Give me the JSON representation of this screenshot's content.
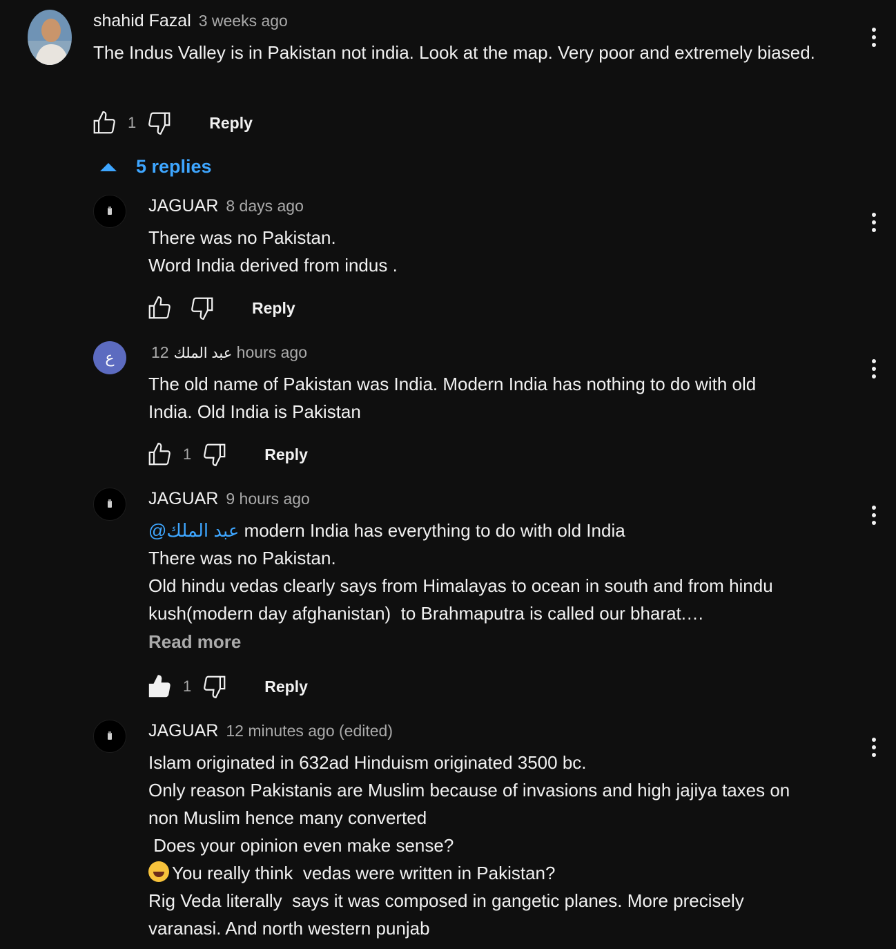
{
  "colors": {
    "background": "#0f0f0f",
    "text": "#f1f1f1",
    "muted": "#aaaaaa",
    "link": "#3ea6ff",
    "avatar_purple": "#5c6bc0"
  },
  "top_comment": {
    "author": "shahid Fazal",
    "time": "3 weeks ago",
    "text": "The Indus Valley is in Pakistan not india. Look at the map. Very poor and extremely biased.",
    "likes": "1",
    "reply_label": "Reply"
  },
  "replies_toggle": {
    "label": "5 replies",
    "icon": "triangle-up-icon"
  },
  "replies": [
    {
      "author": "JAGUAR",
      "time": "8 days ago",
      "lines": [
        "There was no Pakistan.",
        "Word India derived from indus ."
      ],
      "likes": "",
      "reply_label": "Reply"
    },
    {
      "author": "عبد الملك",
      "avatar_letter": "ع",
      "time": "12 hours ago",
      "lines": [
        "The old name of Pakistan was India. Modern India has nothing to do with old",
        "India. Old India is Pakistan"
      ],
      "likes": "1",
      "reply_label": "Reply"
    },
    {
      "author": "JAGUAR",
      "time": "9 hours ago",
      "mention": "@عبد الملك",
      "lines": [
        " modern India has everything to do with old India",
        "There was no Pakistan.",
        "Old hindu vedas clearly says from Himalayas to ocean in south and from hindu",
        "kush(modern day afghanistan)  to Brahmaputra is called our bharat.…"
      ],
      "read_more": "Read more",
      "likes": "1",
      "liked": true,
      "reply_label": "Reply"
    },
    {
      "author": "JAGUAR",
      "time": "12 minutes ago (edited)",
      "lines": [
        "Islam originated in 632ad Hinduism originated 3500 bc.",
        "Only reason Pakistanis are Muslim because of invasions and high jajiya taxes on",
        "non Muslim hence many converted",
        " Does your opinion even make sense?",
        "You really think  vedas were written in Pakistan?",
        "Rig Veda literally  says it was composed in gangetic planes. More precisely",
        "varanasi. And north western punjab"
      ]
    }
  ]
}
